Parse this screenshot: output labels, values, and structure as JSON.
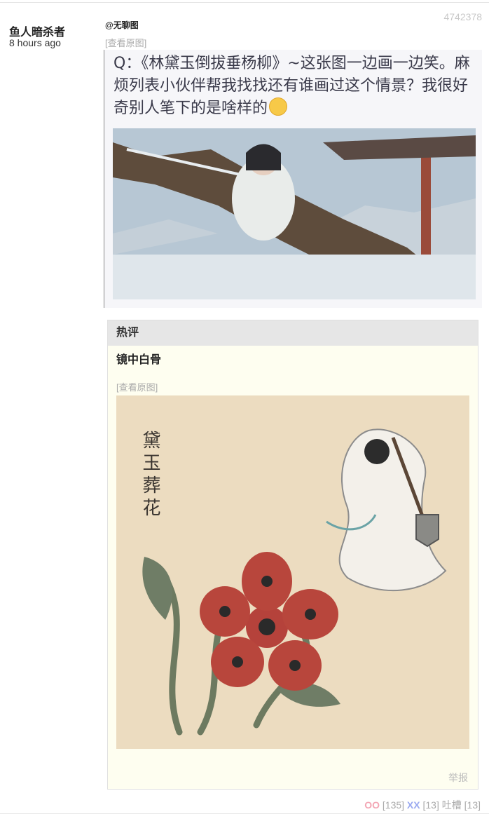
{
  "post": {
    "author": "鱼人暗杀者",
    "time": "8 hours ago",
    "id": "4742378",
    "mention": "@无聊图",
    "view_original": "[查看原图]",
    "image": {
      "question": "Q：《林黛玉倒拔垂杨柳》~这张图一边画一边笑。麻烦列表小伙伴帮我找找还有谁画过这个情景？我很好奇别人笔下的是啥样的"
    }
  },
  "hot_comment": {
    "heading": "热评",
    "user": "镜中白骨",
    "view_original": "[查看原图]",
    "image": {
      "calligraphy": "黛玉葬花"
    },
    "report": "举报"
  },
  "votes": {
    "oo_label": "OO",
    "oo_count": "[135]",
    "xx_label": "XX",
    "xx_count": "[13]",
    "tucao_label": "吐槽 [13]"
  },
  "colors": {
    "oo": "#f3a6b4",
    "xx": "#9aa9f0",
    "hot_bg": "#fefef0"
  }
}
